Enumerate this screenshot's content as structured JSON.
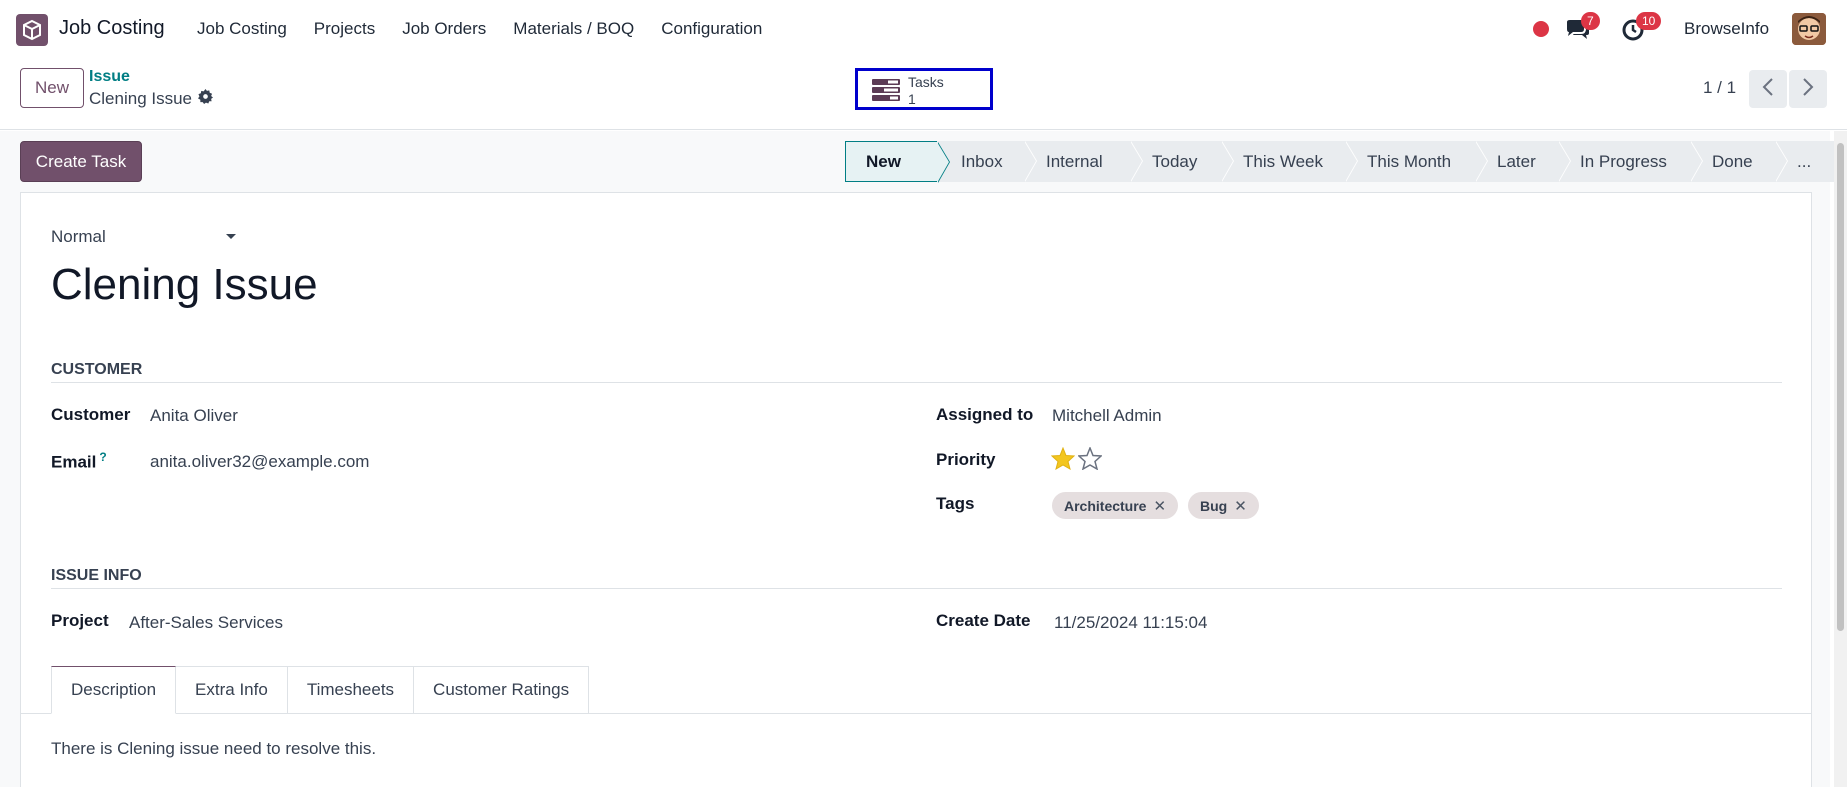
{
  "navbar": {
    "app_name": "Job Costing",
    "menu": [
      "Job Costing",
      "Projects",
      "Job Orders",
      "Materials / BOQ",
      "Configuration"
    ],
    "messages_count": "7",
    "activities_count": "10",
    "user_name": "BrowseInfo",
    "logo_icon": "box-logo-icon",
    "brand_color": "#71506b"
  },
  "control": {
    "new_label": "New",
    "breadcrumb_parent": "Issue",
    "breadcrumb_current": "Clening Issue",
    "smart_button": {
      "label": "Tasks",
      "count": "1"
    },
    "pager": "1 / 1"
  },
  "actions": {
    "create_task_label": "Create Task"
  },
  "stages": [
    "New",
    "Inbox",
    "Internal",
    "Today",
    "This Week",
    "This Month",
    "Later",
    "In Progress",
    "Done",
    "..."
  ],
  "active_stage": "New",
  "form": {
    "priority_select": "Normal",
    "title": "Clening Issue",
    "customer_section": "CUSTOMER",
    "customer_label": "Customer",
    "customer_value": "Anita Oliver",
    "email_label": "Email",
    "email_help": "?",
    "email_value": "anita.oliver32@example.com",
    "assigned_label": "Assigned to",
    "assigned_value": "Mitchell Admin",
    "priority_label": "Priority",
    "priority_stars": 1,
    "priority_max": 2,
    "tags_label": "Tags",
    "tags": [
      "Architecture",
      "Bug"
    ],
    "issue_section": "ISSUE INFO",
    "project_label": "Project",
    "project_value": "After-Sales Services",
    "create_date_label": "Create Date",
    "create_date_value": "11/25/2024 11:15:04"
  },
  "tabs": [
    "Description",
    "Extra Info",
    "Timesheets",
    "Customer Ratings"
  ],
  "active_tab": "Description",
  "description": "There is Clening issue need to resolve this."
}
